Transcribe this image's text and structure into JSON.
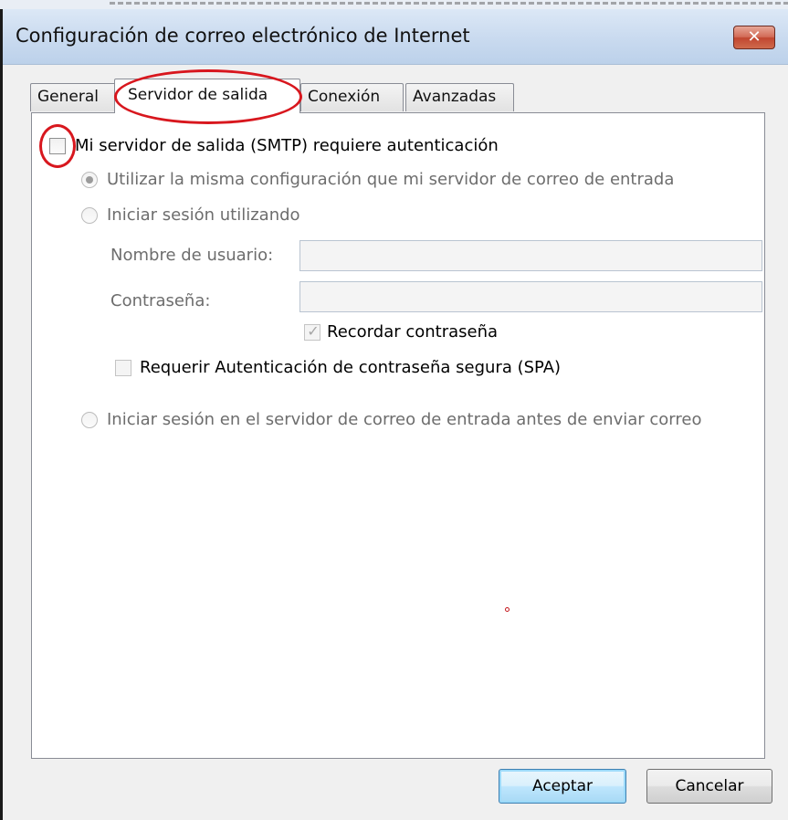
{
  "window": {
    "title": "Configuración de correo electrónico de Internet",
    "close_glyph": "✕"
  },
  "tabs": [
    {
      "label": "General",
      "active": false
    },
    {
      "label": "Servidor de salida",
      "active": true
    },
    {
      "label": "Conexión",
      "active": false
    },
    {
      "label": "Avanzadas",
      "active": false
    }
  ],
  "smtp_auth": {
    "label": "Mi servidor de salida (SMTP) requiere autenticación",
    "checked": false
  },
  "options": {
    "same_config": {
      "label": "Utilizar la misma configuración que mi servidor de correo de entrada",
      "selected": true
    },
    "login_using": {
      "label": "Iniciar sesión utilizando",
      "selected": false
    },
    "login_incoming_first": {
      "label": "Iniciar sesión en el servidor de correo de entrada antes de enviar correo",
      "selected": false
    }
  },
  "credentials": {
    "username_label": "Nombre de usuario:",
    "username_value": "",
    "password_label": "Contraseña:",
    "password_value": "",
    "remember_password_label": "Recordar contraseña",
    "remember_password_checked": true,
    "check_glyph": "✓",
    "spa_label": "Requerir Autenticación de contraseña segura (SPA)",
    "spa_checked": false
  },
  "buttons": {
    "ok": "Aceptar",
    "cancel": "Cancelar"
  },
  "colors": {
    "annotation_red": "#d8171e"
  }
}
